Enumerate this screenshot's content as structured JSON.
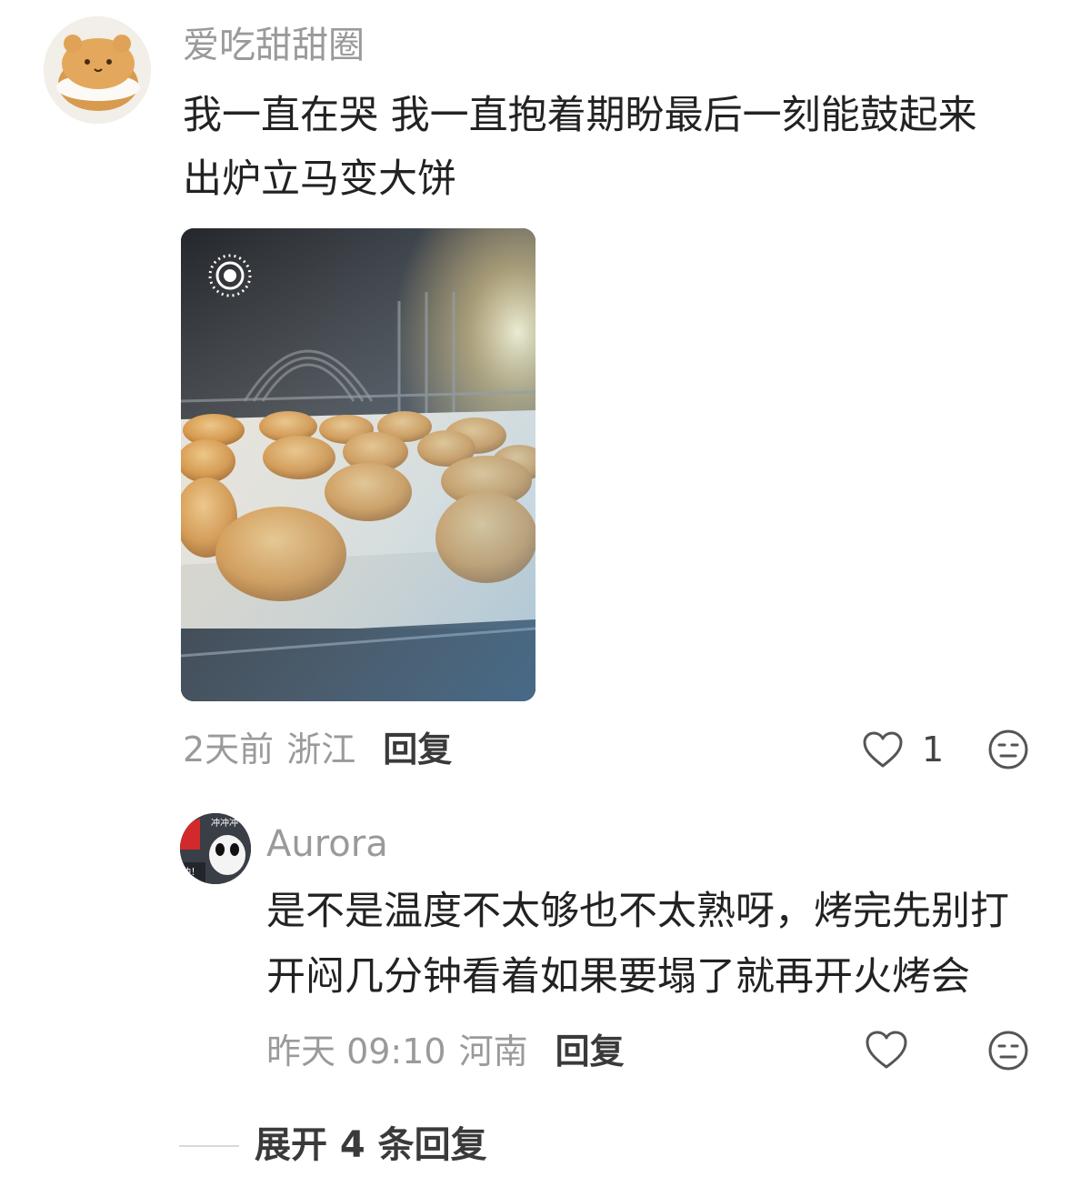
{
  "comment": {
    "username": "爱吃甜甜圈",
    "text": "我一直在哭 我一直抱着期盼最后一刻能鼓起来\n出炉立马变大饼",
    "time": "2天前",
    "location": "浙江",
    "reply_label": "回复",
    "like_count": "1"
  },
  "reply": {
    "username": "Aurora",
    "avatar_text_top": "冲冲冲",
    "avatar_text_side": "冲！",
    "text": "是不是温度不太够也不太熟呀，烤完先别打\n开闷几分钟看着如果要塌了就再开火烤会",
    "time": "昨天 09:10",
    "location": "河南",
    "reply_label": "回复"
  },
  "expand_label": "展开 4 条回复",
  "icons": {
    "like": "heart-icon",
    "emoji": "emoji-face-icon",
    "live_photo": "live-photo-icon"
  }
}
